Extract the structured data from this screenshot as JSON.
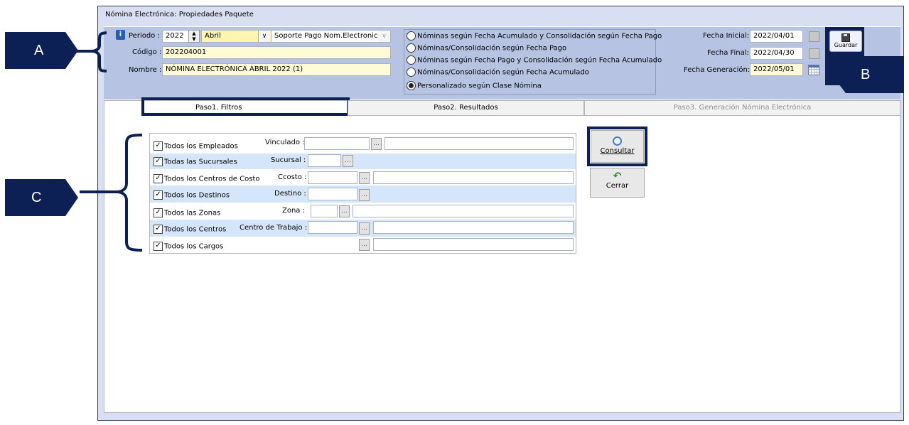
{
  "window": {
    "title": "Nómina Electrónica: Propiedades Paquete"
  },
  "header": {
    "periodo_label": "Periodo :",
    "year": "2022",
    "month": "Abril",
    "soporte": "Soporte Pago Nom.Electronica",
    "codigo_label": "Código :",
    "codigo": "202204001",
    "nombre_label": "Nombre :",
    "nombre": "NÓMINA ELECTRÓNICA ABRIL 2022 (1)"
  },
  "radios": [
    {
      "label": "Nóminas según Fecha Acumulado y Consolidación según Fecha Pago",
      "selected": false
    },
    {
      "label": "Nóminas/Consolidación según Fecha Pago",
      "selected": false
    },
    {
      "label": "Nóminas según Fecha Pago y Consolidación según Fecha Acumulado",
      "selected": false
    },
    {
      "label": "Nóminas/Consolidación según Fecha Acumulado",
      "selected": false
    },
    {
      "label": "Personalizado según Clase Nómina",
      "selected": true
    }
  ],
  "dates": {
    "inicial_label": "Fecha Inicial:",
    "inicial": "2022/04/01",
    "final_label": "Fecha Final:",
    "final": "2022/04/30",
    "generacion_label": "Fecha Generación:",
    "generacion": "2022/05/01"
  },
  "toolbar": {
    "guardar": "Guardar",
    "consultar": "Consultar",
    "cerrar": "Cerrar"
  },
  "tabs": [
    "Paso1. Filtros",
    "Paso2. Resultados",
    "Paso3. Generación Nómina Electrónica"
  ],
  "filters": [
    {
      "check": "Todos los Empleados",
      "field": "Vinculado :"
    },
    {
      "check": "Todas las Sucursales",
      "field": "Sucursal :"
    },
    {
      "check": "Todos los Centros de Costo",
      "field": "Ccosto :"
    },
    {
      "check": "Todos los Destinos",
      "field": "Destino :"
    },
    {
      "check": "Todos las Zonas",
      "field": "Zona :"
    },
    {
      "check": "Todos los Centros",
      "field": "Centro de Trabajo :"
    },
    {
      "check": "Todos los Cargos",
      "field": ""
    }
  ],
  "callouts": {
    "a": "A",
    "b": "B",
    "c": "C"
  },
  "icons": {
    "info": "info-icon",
    "save": "floppy-icon",
    "search": "magnifier-icon",
    "close": "undo-arrow-icon",
    "calendar": "calendar-icon"
  },
  "colors": {
    "header_bg": "#b6c3e2",
    "callout": "#0c2055",
    "yellow_field": "#fffbd6",
    "row_band": "#d5e5fa"
  }
}
